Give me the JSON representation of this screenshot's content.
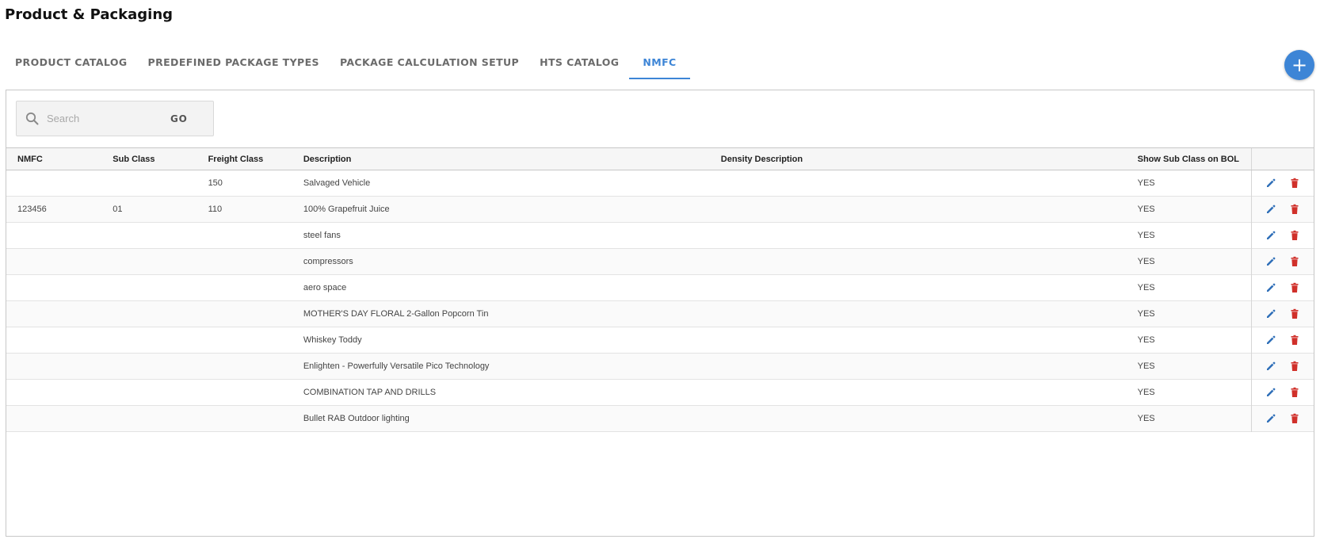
{
  "page": {
    "title": "Product & Packaging"
  },
  "tabs": [
    {
      "label": "PRODUCT CATALOG",
      "active": false
    },
    {
      "label": "PREDEFINED PACKAGE TYPES",
      "active": false
    },
    {
      "label": "PACKAGE CALCULATION SETUP",
      "active": false
    },
    {
      "label": "HTS CATALOG",
      "active": false
    },
    {
      "label": "NMFC",
      "active": true
    }
  ],
  "toolbar": {
    "add_button_label": "+"
  },
  "search": {
    "placeholder": "Search",
    "value": "",
    "go_label": "GO"
  },
  "table": {
    "columns": [
      "NMFC",
      "Sub Class",
      "Freight Class",
      "Description",
      "Density Description",
      "Show Sub Class on BOL",
      ""
    ],
    "rows": [
      {
        "nmfc": "",
        "sub_class": "",
        "freight_class": "150",
        "description": "Salvaged Vehicle",
        "density_description": "",
        "show_sub_class": "YES"
      },
      {
        "nmfc": "123456",
        "sub_class": "01",
        "freight_class": "110",
        "description": "100% Grapefruit Juice",
        "density_description": "",
        "show_sub_class": "YES"
      },
      {
        "nmfc": "",
        "sub_class": "",
        "freight_class": "",
        "description": "steel fans",
        "density_description": "",
        "show_sub_class": "YES"
      },
      {
        "nmfc": "",
        "sub_class": "",
        "freight_class": "",
        "description": "compressors",
        "density_description": "",
        "show_sub_class": "YES"
      },
      {
        "nmfc": "",
        "sub_class": "",
        "freight_class": "",
        "description": "aero space",
        "density_description": "",
        "show_sub_class": "YES"
      },
      {
        "nmfc": "",
        "sub_class": "",
        "freight_class": "",
        "description": "MOTHER'S DAY FLORAL 2-Gallon Popcorn Tin",
        "density_description": "",
        "show_sub_class": "YES"
      },
      {
        "nmfc": "",
        "sub_class": "",
        "freight_class": "",
        "description": "Whiskey Toddy",
        "density_description": "",
        "show_sub_class": "YES"
      },
      {
        "nmfc": "",
        "sub_class": "",
        "freight_class": "",
        "description": "Enlighten - Powerfully Versatile Pico Technology",
        "density_description": "",
        "show_sub_class": "YES"
      },
      {
        "nmfc": "",
        "sub_class": "",
        "freight_class": "",
        "description": "COMBINATION TAP AND DRILLS",
        "density_description": "",
        "show_sub_class": "YES"
      },
      {
        "nmfc": "",
        "sub_class": "",
        "freight_class": "",
        "description": "Bullet RAB Outdoor lighting",
        "density_description": "",
        "show_sub_class": "YES"
      }
    ]
  },
  "icons": {
    "edit": "pencil-icon",
    "delete": "trash-icon",
    "search": "search-icon"
  },
  "colors": {
    "accent": "#3d85d6",
    "edit_icon": "#2f6fb8",
    "delete_icon": "#d0302a"
  }
}
